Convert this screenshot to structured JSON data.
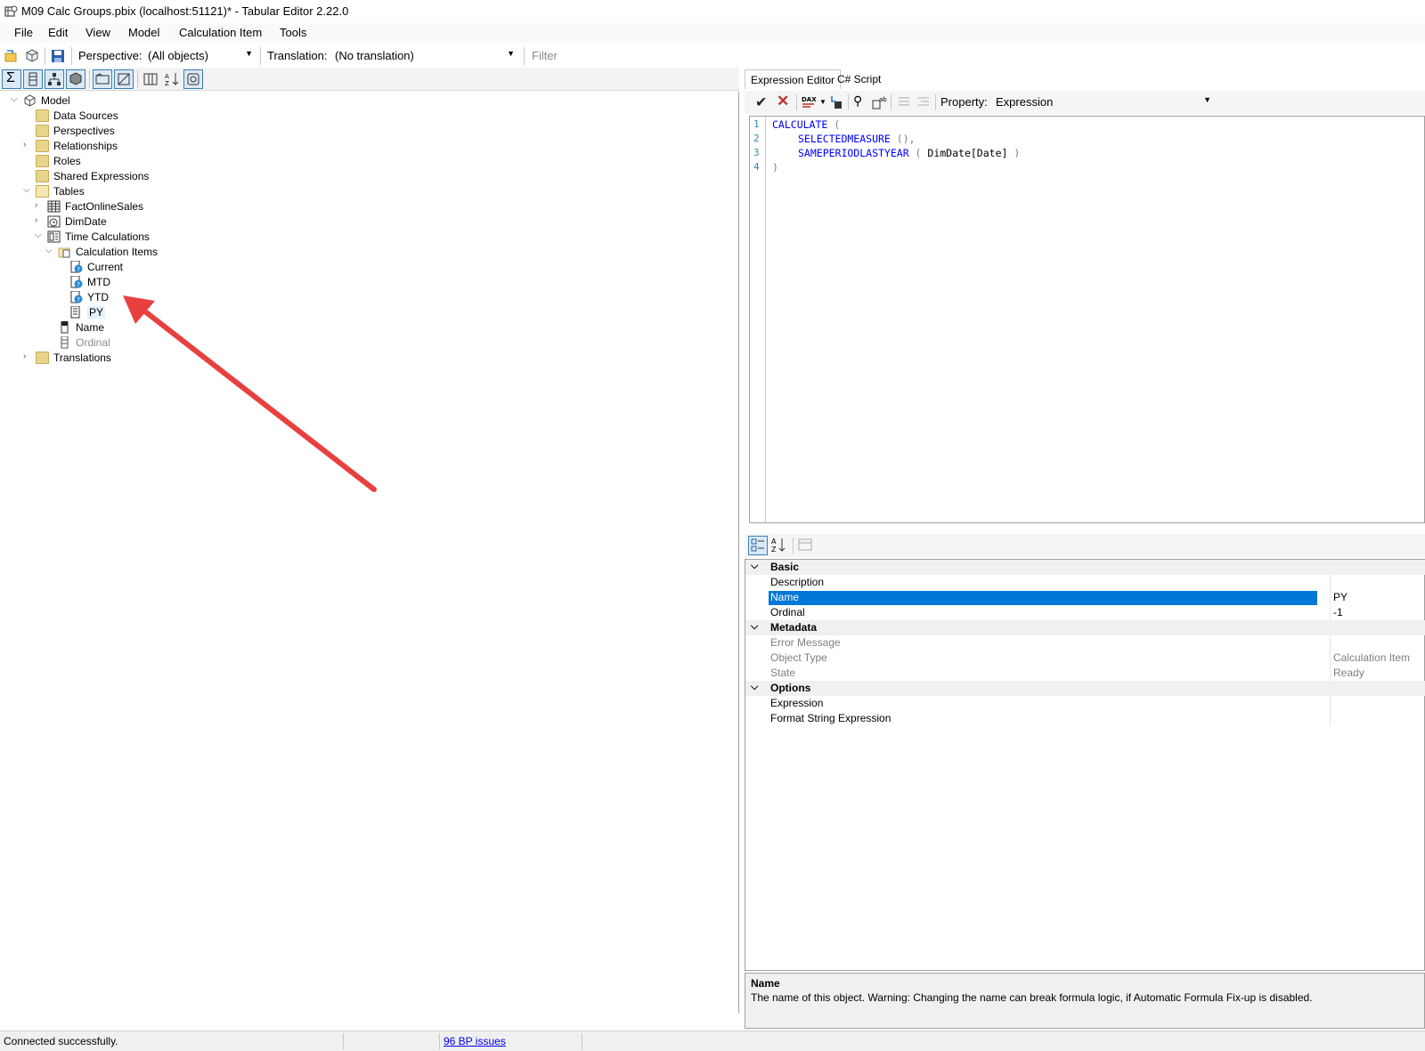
{
  "window": {
    "title": "M09 Calc Groups.pbix (localhost:51121)* - Tabular Editor 2.22.0"
  },
  "menu": [
    "File",
    "Edit",
    "View",
    "Model",
    "Calculation Item",
    "Tools"
  ],
  "toolbar": {
    "perspective_label": "Perspective:",
    "perspective_value": "(All objects)",
    "translation_label": "Translation:",
    "translation_value": "(No translation)",
    "filter_placeholder": "Filter"
  },
  "tree": {
    "model": "Model",
    "data_sources": "Data Sources",
    "perspectives": "Perspectives",
    "relationships": "Relationships",
    "roles": "Roles",
    "shared_expressions": "Shared Expressions",
    "tables": "Tables",
    "fact_online_sales": "FactOnlineSales",
    "dim_date": "DimDate",
    "time_calculations": "Time Calculations",
    "calculation_items": "Calculation Items",
    "items": [
      "Current",
      "MTD",
      "YTD",
      "PY"
    ],
    "name_col": "Name",
    "ordinal_col": "Ordinal",
    "translations": "Translations"
  },
  "editor": {
    "tabs": [
      "Expression Editor",
      "C# Script"
    ],
    "property_label": "Property:",
    "property_value": "Expression",
    "line_numbers": [
      "1",
      "2",
      "3",
      "4"
    ],
    "code": {
      "l1_kw": "CALCULATE",
      "l1_p": " (",
      "l2_kw": "SELECTEDMEASURE",
      "l2_p": " (),",
      "l3_kw": "SAMEPERIODLASTYEAR",
      "l3_p1": " ( ",
      "l3_t": "DimDate[Date]",
      "l3_p2": " )",
      "l4_p": ")"
    }
  },
  "properties": {
    "cat_basic": "Basic",
    "description": "Description",
    "name": "Name",
    "name_value": "PY",
    "ordinal": "Ordinal",
    "ordinal_value": "-1",
    "cat_metadata": "Metadata",
    "error_message": "Error Message",
    "object_type": "Object Type",
    "object_type_value": "Calculation Item",
    "state": "State",
    "state_value": "Ready",
    "cat_options": "Options",
    "expression": "Expression",
    "format_string": "Format String Expression"
  },
  "description": {
    "title": "Name",
    "text": "The name of this object. Warning: Changing the name can break formula logic, if Automatic Formula Fix-up is disabled."
  },
  "status": {
    "message": "Connected successfully.",
    "bp_issues": "96 BP issues"
  },
  "colors": {
    "selection": "#0078d7",
    "annotation_arrow": "#e8403f",
    "dax_keyword": "#0000ff"
  }
}
